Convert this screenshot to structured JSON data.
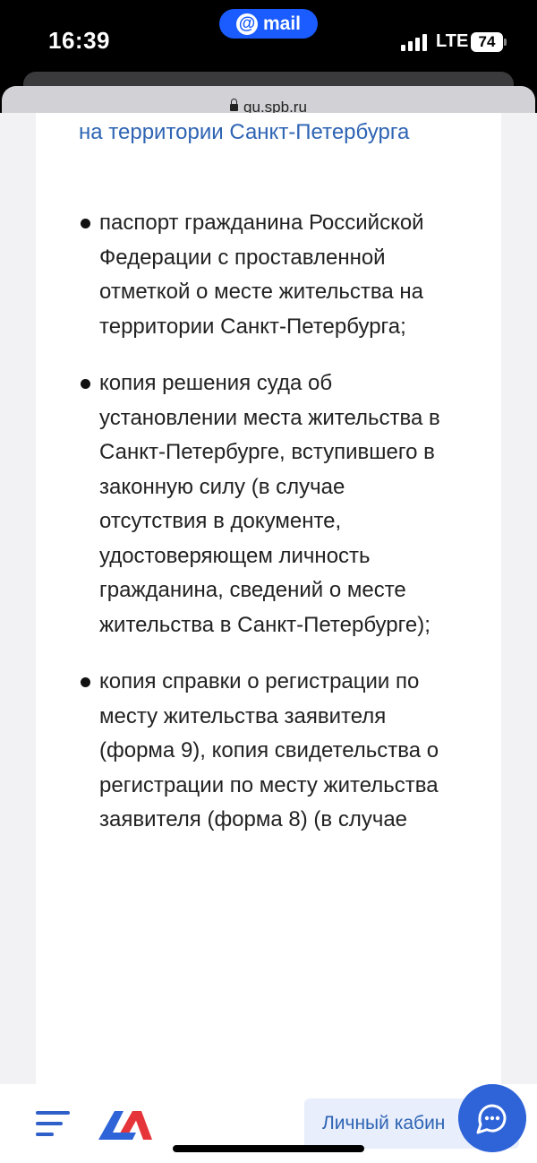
{
  "status_bar": {
    "time": "16:39",
    "mail_label": "mail",
    "network": "LTE",
    "battery": "74"
  },
  "browser": {
    "url": "gu.spb.ru"
  },
  "content": {
    "link_text": "на территории Санкт-Петербурга",
    "bullets": [
      "паспорт гражданина Российской Федерации с проставленной отметкой о месте жительства на территории Санкт-Петербурга;",
      "копия решения суда об установлении места жительства в Санкт-Петербурге, вступившего в законную силу (в случае отсутствия в документе, удостоверяющем личность гражданина, сведений о месте жительства в Санкт-Петербурге);",
      "копия справки о регистрации по месту жительства заявителя (форма 9), копия свидетельства о регистрации по месту жительства заявителя (форма 8) (в случае"
    ]
  },
  "bottom_bar": {
    "cabinet_label": "Личный кабин",
    "menu_icon": "hamburger-menu-icon",
    "logo_icon": "gosuslugi-logo-icon",
    "chat_icon": "chat-bubble-icon"
  },
  "colors": {
    "link": "#2e64b3",
    "accent": "#2f64d8",
    "logo_blue": "#2f64d8",
    "logo_red": "#e6353a"
  }
}
